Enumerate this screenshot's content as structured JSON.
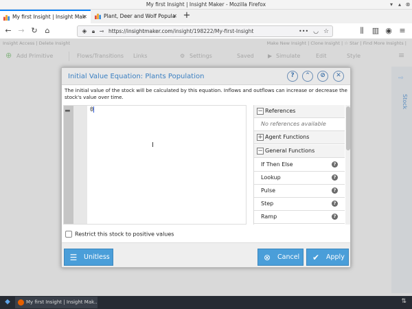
{
  "window": {
    "title": "My first Insight | Insight Maker - Mozilla Firefox"
  },
  "tabs": [
    {
      "label": "My first Insight | Insight Mak",
      "active": true
    },
    {
      "label": "Plant, Deer and Wolf Popula",
      "active": false
    }
  ],
  "nav": {
    "url_host": "https://insightmaker.com",
    "url_path": "/insight/198222/My-first-Insight",
    "more": "•••"
  },
  "page": {
    "links_left": "Insight Access | Delete Insight",
    "links_right": "Make New Insight | Clone Insight | ☆ Star | Find More Insights |",
    "toolbar": {
      "add_primitive": "Add Primitive",
      "flows_transitions": "Flows/Transitions",
      "links": "Links",
      "settings": "Settings",
      "saved": "Saved",
      "simulate": "Simulate",
      "edit": "Edit",
      "style": "Style"
    },
    "side_tab": "Stock"
  },
  "dialog": {
    "title": "Initial Value Equation: Plants Population",
    "description": "The initial value of the stock will be calculated by this equation. Inflows and outflows can increase or decrease the stock's value over time.",
    "editor_text": "0",
    "references": {
      "header": "References",
      "empty_note": "No references available"
    },
    "agent_functions": "Agent Functions",
    "general_functions": "General Functions",
    "functions": [
      "If Then Else",
      "Lookup",
      "Pulse",
      "Step",
      "Ramp"
    ],
    "restrict_label": "Restrict this stock to positive values",
    "restrict_checked": false,
    "unitless_label": "Unitless",
    "cancel_label": "Cancel",
    "apply_label": "Apply"
  },
  "taskbar": {
    "item": "My first Insight | Insight Mak..."
  },
  "colors": {
    "accent": "#4a9ed9",
    "title_blue": "#3a7fc1",
    "tab_active": "#0a84ff",
    "taskbar": "#262b33"
  }
}
